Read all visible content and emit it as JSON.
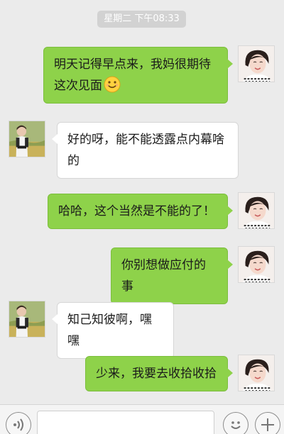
{
  "header": {
    "timestamp": "星期二 下午08:33"
  },
  "messages": [
    {
      "side": "out",
      "lines": [
        "明天记得早点来，我妈很期待",
        "这次见面"
      ],
      "emoji": "smiley-icon"
    },
    {
      "side": "in",
      "lines": [
        "好的呀，能不能透露点内幕啥",
        "的"
      ]
    },
    {
      "side": "out",
      "lines": [
        "哈哈，这个当然是不能的了！"
      ]
    },
    {
      "side": "out",
      "lines": [
        "你别想做应付的事"
      ]
    },
    {
      "side": "in",
      "lines": [
        "知己知彼啊，嘿嘿"
      ]
    },
    {
      "side": "out",
      "lines": [
        "少来，我要去收拾收拾"
      ]
    }
  ],
  "colors": {
    "outgoing_bubble": "#8ed24a",
    "incoming_bubble": "#ffffff",
    "background": "#ebebeb"
  },
  "input_bar": {
    "voice_icon": "voice-icon",
    "emoji_icon": "emoji-icon",
    "plus_icon": "plus-icon"
  }
}
